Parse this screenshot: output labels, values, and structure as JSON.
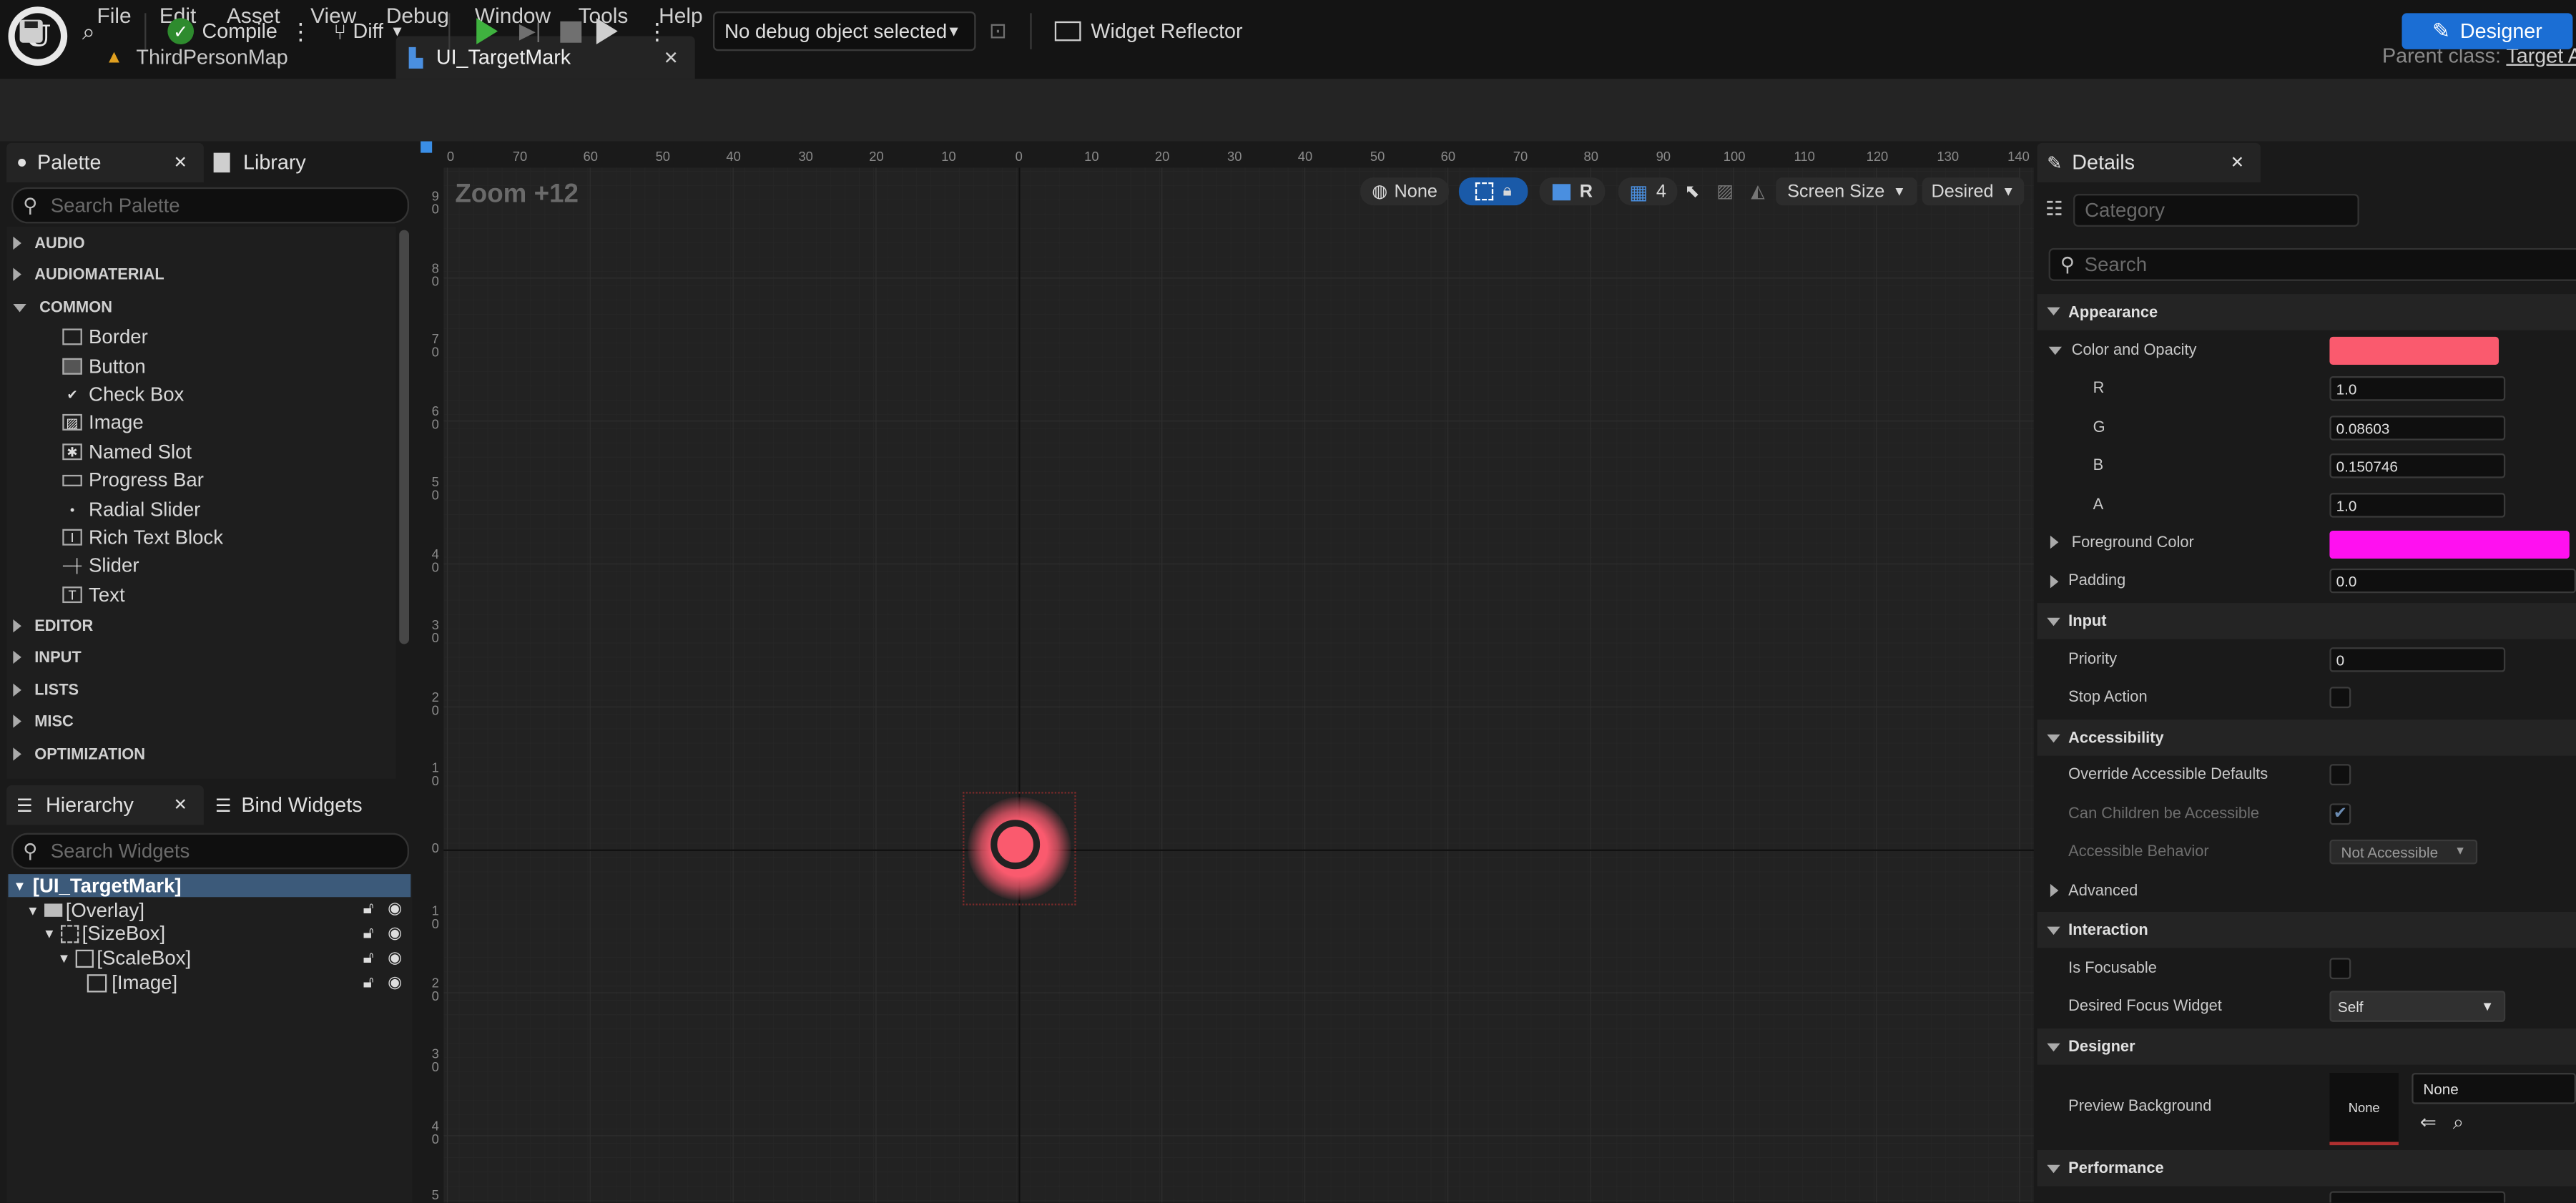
{
  "menu": {
    "items": [
      "File",
      "Edit",
      "Asset",
      "View",
      "Debug",
      "Window",
      "Tools",
      "Help"
    ]
  },
  "tabs": [
    {
      "label": "ThirdPersonMap"
    },
    {
      "label": "UI_TargetMark"
    }
  ],
  "header": {
    "parent_class_label": "Parent class:",
    "parent_class_value": "Target A"
  },
  "toolbar": {
    "compile_label": "Compile",
    "diff_label": "Diff",
    "debug_object": "No debug object selected",
    "widget_reflector_label": "Widget Reflector",
    "designer_label": "Designer"
  },
  "palette": {
    "tab_label": "Palette",
    "library_label": "Library",
    "search_placeholder": "Search Palette",
    "categories_top": [
      "AUDIO",
      "AUDIOMATERIAL",
      "COMMON"
    ],
    "common_items": [
      "Border",
      "Button",
      "Check Box",
      "Image",
      "Named Slot",
      "Progress Bar",
      "Radial Slider",
      "Rich Text Block",
      "Slider",
      "Text"
    ],
    "categories_bottom": [
      "EDITOR",
      "INPUT",
      "LISTS",
      "MISC",
      "OPTIMIZATION"
    ]
  },
  "hierarchy": {
    "tab_label": "Hierarchy",
    "bind_widgets_label": "Bind Widgets",
    "search_placeholder": "Search Widgets",
    "items": [
      "[UI_TargetMark]",
      "[Overlay]",
      "[SizeBox]",
      "[ScaleBox]",
      "[Image]"
    ]
  },
  "viewport": {
    "zoom": "Zoom +12",
    "none_label": "None",
    "r_label": "R",
    "grid_count": "4",
    "screen_size_label": "Screen Size",
    "desired_label": "Desired",
    "ruler_h": [
      "0",
      "70",
      "60",
      "50",
      "40",
      "30",
      "20",
      "10",
      "0",
      "10",
      "20",
      "30",
      "40",
      "50",
      "60",
      "70",
      "80",
      "90",
      "100",
      "110",
      "120",
      "130",
      "140"
    ],
    "ruler_v": [
      "9\n0",
      "8\n0",
      "7\n0",
      "6\n0",
      "5\n0",
      "4\n0",
      "3\n0",
      "2\n0",
      "1\n0",
      "0",
      "1\n0",
      "2\n0",
      "3\n0",
      "4\n0",
      "5"
    ]
  },
  "details": {
    "tab_label": "Details",
    "category_placeholder": "Category",
    "search_placeholder": "Search",
    "appearance": "Appearance",
    "color_opacity": "Color and Opacity",
    "color_swatch": "#fa5a6e",
    "r_label": "R",
    "r_value": "1.0",
    "g_label": "G",
    "g_value": "0.08603",
    "b_label": "B",
    "b_value": "0.150746",
    "a_label": "A",
    "a_value": "1.0",
    "foreground_color": "Foreground Color",
    "foreground_swatch": "#ff10f0",
    "padding": "Padding",
    "padding_value": "0.0",
    "input": "Input",
    "priority": "Priority",
    "priority_value": "0",
    "stop_action": "Stop Action",
    "accessibility": "Accessibility",
    "override_accessible": "Override Accessible Defaults",
    "children_accessible": "Can Children be Accessible",
    "accessible_behavior": "Accessible Behavior",
    "accessible_behavior_value": "Not Accessible",
    "advanced": "Advanced",
    "interaction": "Interaction",
    "is_focusable": "Is Focusable",
    "desired_focus": "Desired Focus Widget",
    "desired_focus_value": "Self",
    "designer": "Designer",
    "preview_background": "Preview Background",
    "preview_thumb": "None",
    "preview_value": "None",
    "performance": "Performance"
  }
}
